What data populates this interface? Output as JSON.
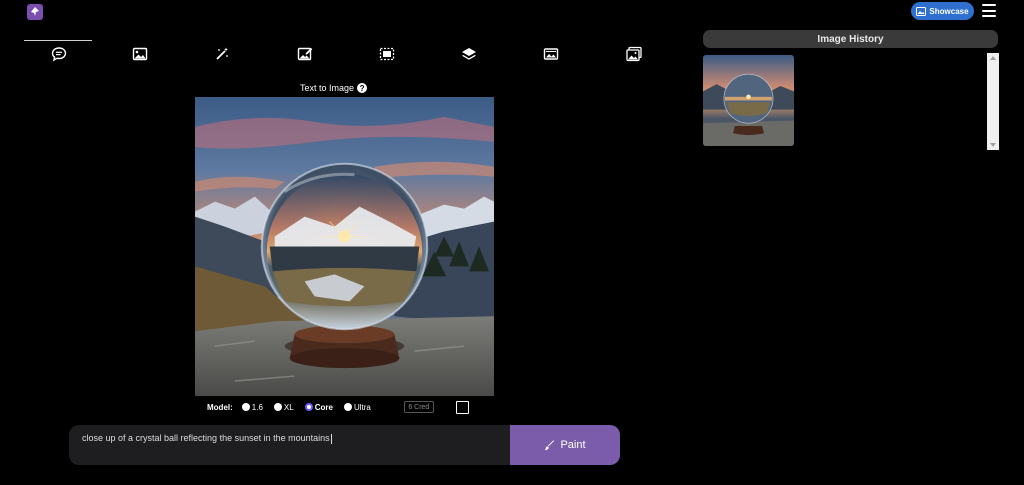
{
  "header": {
    "logo_icon": "rocket-app-logo",
    "showcase_label": "Showcase",
    "showcase_icon": "gallery-icon",
    "menu_icon": "hamburger-menu-icon"
  },
  "tools": [
    {
      "name": "text-to-image",
      "icon": "chat-bubble-icon",
      "active": true
    },
    {
      "name": "image-to-image",
      "icon": "image-icon"
    },
    {
      "name": "sketch",
      "icon": "magic-wand-icon"
    },
    {
      "name": "inpaint",
      "icon": "edit-image-icon"
    },
    {
      "name": "outpaint",
      "icon": "selection-frame-icon"
    },
    {
      "name": "layers",
      "icon": "layers-icon"
    },
    {
      "name": "remove-background",
      "icon": "panorama-icon"
    },
    {
      "name": "gallery",
      "icon": "images-icon"
    }
  ],
  "section": {
    "title": "Text to Image",
    "help_glyph": "?"
  },
  "main_image": {
    "subject": "crystal ball reflecting mountain sunset"
  },
  "model": {
    "label": "Model:",
    "options": [
      {
        "label": "1.6",
        "selected": false
      },
      {
        "label": "XL",
        "selected": false
      },
      {
        "label": "Core",
        "selected": true
      },
      {
        "label": "Ultra",
        "selected": false
      }
    ],
    "credits": "6 Cred"
  },
  "prompt": {
    "value": "close up of a crystal ball reflecting the sunset in the mountains",
    "paint_label": "Paint",
    "paint_icon": "brush-icon"
  },
  "history": {
    "title": "Image History",
    "items_count": 1
  },
  "colors": {
    "accent": "#7b5cab",
    "showcase": "#2f6fcf",
    "background": "#000000"
  }
}
